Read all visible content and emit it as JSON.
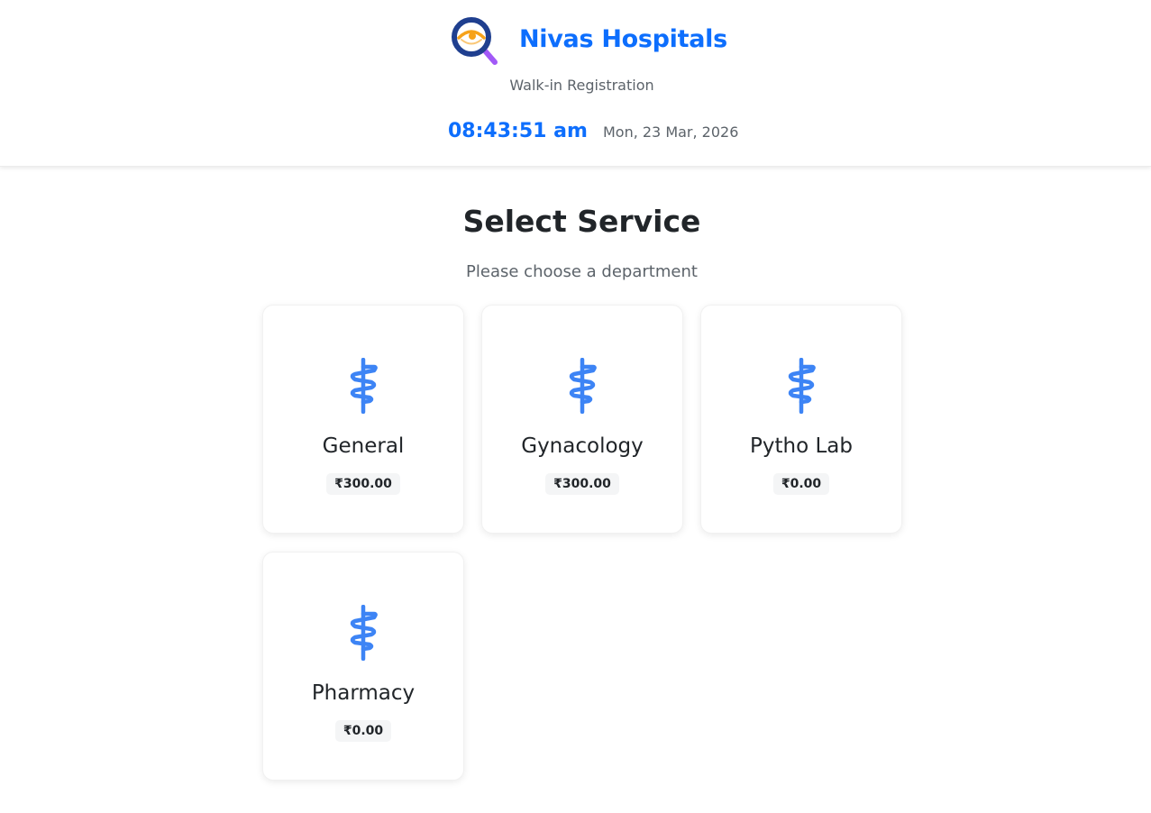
{
  "header": {
    "hospital_name": "Nivas Hospitals",
    "subtitle": "Walk-in Registration",
    "time": "08:43:51 am",
    "date": "Mon, 23 Mar, 2026",
    "logo_icon": "magnifier-eye-logo-icon"
  },
  "main": {
    "title": "Select Service",
    "subtitle": "Please choose a department"
  },
  "services": [
    {
      "name": "General",
      "price": "₹300.00",
      "icon": "medical-staff-icon"
    },
    {
      "name": "Gynacology",
      "price": "₹300.00",
      "icon": "medical-staff-icon"
    },
    {
      "name": "Pytho Lab",
      "price": "₹0.00",
      "icon": "medical-staff-icon"
    },
    {
      "name": "Pharmacy",
      "price": "₹0.00",
      "icon": "medical-staff-icon"
    }
  ],
  "colors": {
    "accent": "#0d6efd",
    "icon_blue": "#3d84f5",
    "logo_orange": "#f6a21a",
    "logo_purple": "#a259f7",
    "logo_navy": "#1f3f8f"
  }
}
